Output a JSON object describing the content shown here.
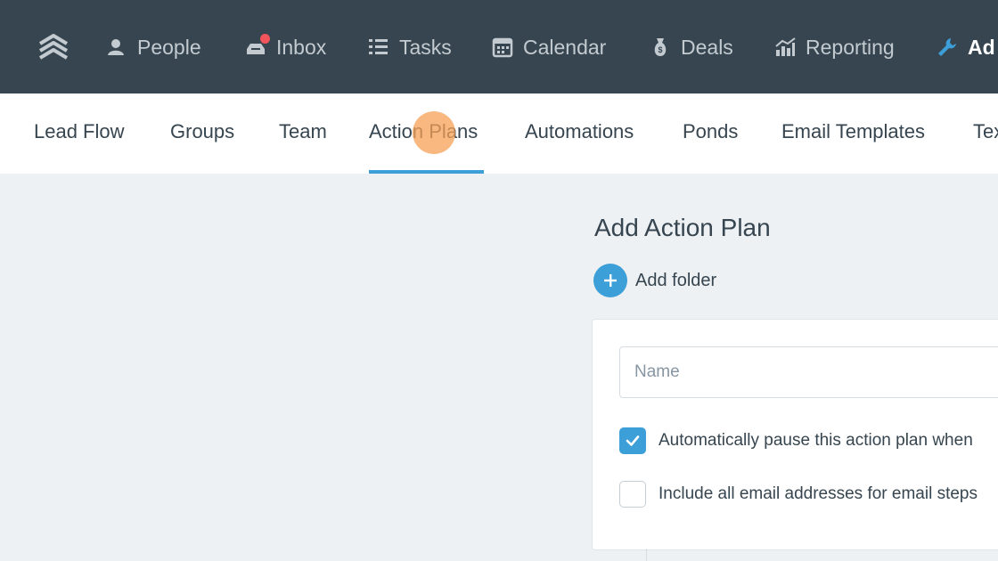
{
  "app": {
    "colors": {
      "topbar": "#36454f",
      "accent": "#3d9fd8",
      "badge": "#f2545b",
      "cursor_highlight": "#f5a055"
    }
  },
  "topnav": {
    "logo_icon": "stacked-chevrons-logo",
    "items": [
      {
        "label": "People",
        "icon": "person-icon"
      },
      {
        "label": "Inbox",
        "icon": "inbox-icon",
        "has_badge": true
      },
      {
        "label": "Tasks",
        "icon": "list-icon"
      },
      {
        "label": "Calendar",
        "icon": "calendar-icon"
      },
      {
        "label": "Deals",
        "icon": "money-bag-icon"
      },
      {
        "label": "Reporting",
        "icon": "chart-icon"
      },
      {
        "label": "Ad",
        "icon": "wrench-icon",
        "active": true
      }
    ]
  },
  "subnav": {
    "tabs": [
      {
        "label": "Lead Flow"
      },
      {
        "label": "Groups"
      },
      {
        "label": "Team"
      },
      {
        "label": "Action Plans",
        "active": true
      },
      {
        "label": "Automations"
      },
      {
        "label": "Ponds"
      },
      {
        "label": "Email Templates"
      },
      {
        "label": "Tex"
      }
    ]
  },
  "main": {
    "title": "Add Action Plan",
    "add_folder": {
      "label": "Add folder",
      "icon": "plus-icon"
    },
    "form": {
      "name_placeholder": "Name",
      "name_value": "",
      "options": [
        {
          "label": "Automatically pause this action plan when",
          "checked": true
        },
        {
          "label": "Include all email addresses for email steps",
          "checked": false
        }
      ]
    }
  }
}
